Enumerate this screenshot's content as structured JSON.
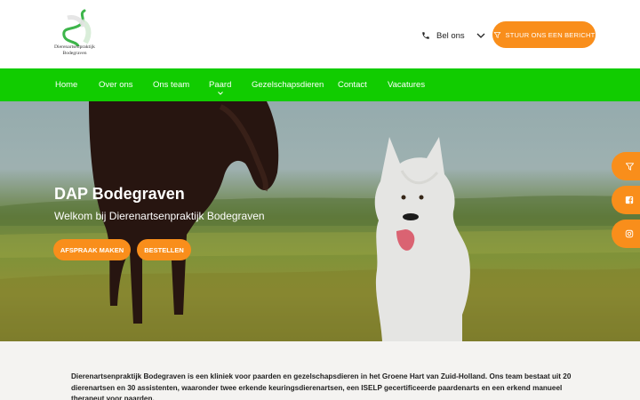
{
  "brand": {
    "logo_text_line1": "Dierenartsenpraktijk",
    "logo_text_line2": "Bodegraven",
    "logo_color": "#3db54a"
  },
  "header": {
    "phone_icon": "phone-icon",
    "phone_label": "Bel ons",
    "cta_icon": "send-icon",
    "cta_label": "STUUR ONS EEN BERICHT"
  },
  "nav": {
    "items": [
      {
        "label": "Home"
      },
      {
        "label": "Over ons"
      },
      {
        "label": "Ons team"
      },
      {
        "label": "Paard"
      },
      {
        "label": "Gezelschapsdieren"
      },
      {
        "label": "Contact"
      },
      {
        "label": "Vacatures"
      }
    ]
  },
  "hero": {
    "title": "DAP Bodegraven",
    "subtitle": "Welkom bij Dierenartsenpraktijk Bodegraven",
    "btn_afspraak": "AFSPRAAK MAKEN",
    "btn_bestellen": "BESTELLEN"
  },
  "side": {
    "items": [
      {
        "icon": "send-icon"
      },
      {
        "icon": "facebook-icon"
      },
      {
        "icon": "instagram-icon"
      }
    ]
  },
  "intro": {
    "text": "Dierenartsenpraktijk Bodegraven is een kliniek voor paarden en gezelschapsdieren in het Groene Hart van Zuid-Holland. Ons team bestaat uit 20 dierenartsen en 30 assistenten, waaronder twee erkende keuringsdierenartsen, een ISELP gecertificeerde paardenarts en een erkend manueel therapeut voor paarden."
  },
  "colors": {
    "accent": "#f98e1b",
    "nav": "#11cc00",
    "intro_bg": "#f4f3f1"
  }
}
